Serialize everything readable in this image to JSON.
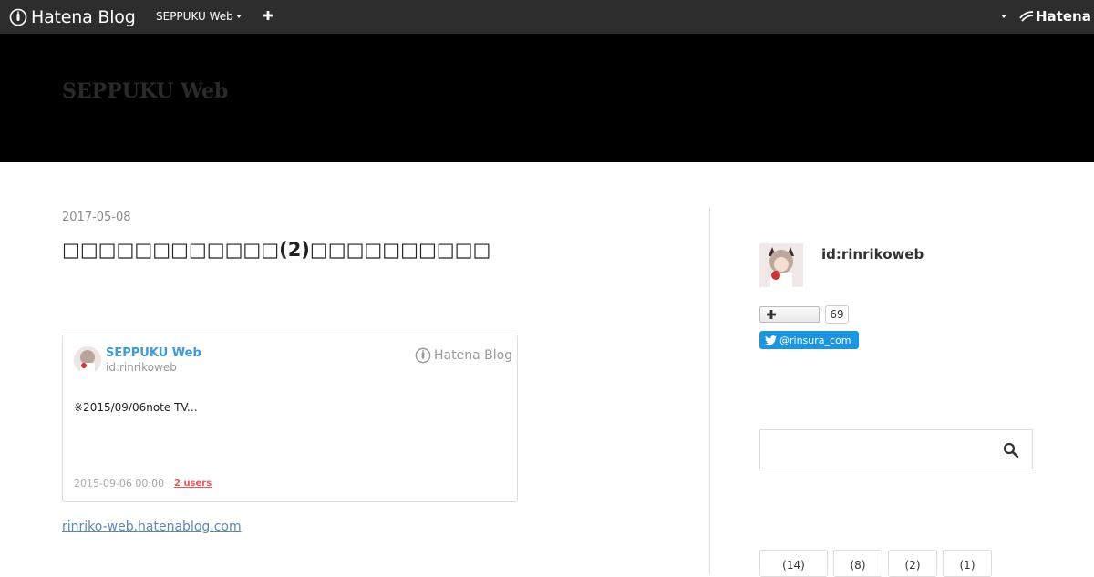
{
  "topbar": {
    "brand": "Hatena Blog",
    "blog_menu": "SEPPUKU Web",
    "hatena_brand": "Hatena"
  },
  "header": {
    "blog_title": "SEPPUKU Web"
  },
  "entry": {
    "date": "2017-05-08",
    "title": "□□□□□□□□□□□□(2)□□□□□□□□□□",
    "link": "rinriko-web.hatenablog.com"
  },
  "card": {
    "blog_name": "SEPPUKU Web",
    "author_id": "id:rinrikoweb",
    "brand": "Hatena Blog",
    "description": "※2015/09/06note  TV...",
    "date": "2015-09-06 00:00",
    "users": "2 users"
  },
  "sidebar": {
    "user_id": "id:rinrikoweb",
    "subscribe_count": "69",
    "twitter_handle": "@rinsura_com",
    "search_placeholder": "",
    "tags": [
      "(14)",
      "(8)",
      "(2)",
      "(1)"
    ]
  },
  "colors": {
    "topbar": "#2d2d2d",
    "header": "#000000",
    "link": "#3f9bd5",
    "twitter": "#1b95e0",
    "users": "#f0555a"
  }
}
